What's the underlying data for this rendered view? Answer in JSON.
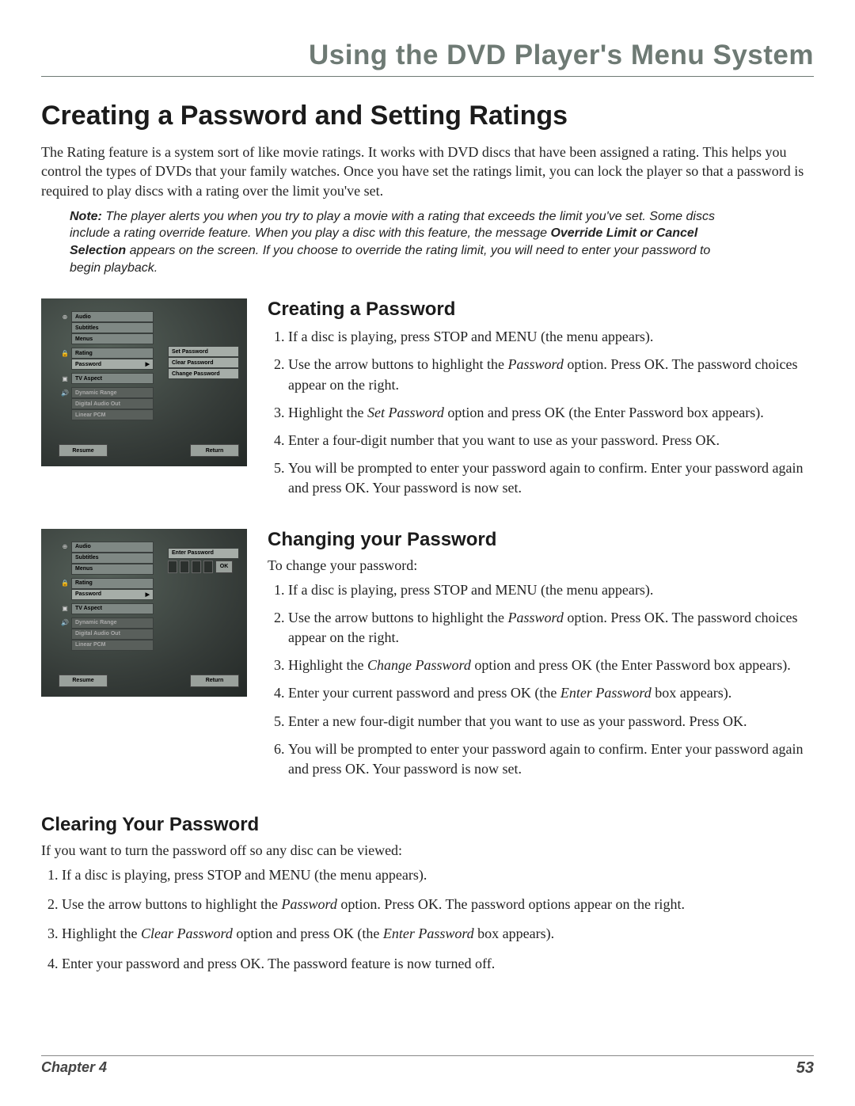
{
  "header": {
    "title": "Using the DVD Player's Menu System"
  },
  "main_heading": "Creating a Password and Setting Ratings",
  "intro": "The Rating feature is a system sort of like movie ratings. It works with DVD discs that have been assigned a rating. This helps you control the types of DVDs that your family watches. Once you have set the ratings limit, you can lock the player so that a password is required to play discs with a rating over the limit you've set.",
  "note": {
    "label": "Note:",
    "part1": " The player alerts you when you try to play a movie with a rating that exceeds the limit you've set. Some discs include a rating override feature. When you play a disc with this feature, the message ",
    "bold2": "Override Limit or Cancel Selection",
    "part2": " appears on the screen. If you choose to override the rating limit, you will need to enter your password to begin playback."
  },
  "creating": {
    "heading": "Creating a Password",
    "steps": [
      "If a disc is playing, press STOP and MENU (the menu appears).",
      "Use the arrow buttons to highlight the Password option. Press OK. The password choices appear on the right.",
      "Highlight the Set Password option and press OK (the Enter Password box appears).",
      "Enter a four-digit number that you want to use as your password. Press OK.",
      "You will be prompted to enter your password again to confirm. Enter your password again and press OK. Your password is now set."
    ]
  },
  "changing": {
    "heading": "Changing your Password",
    "intro": "To change your password:",
    "steps": [
      "If a disc is playing, press STOP and MENU (the menu appears).",
      "Use the arrow buttons to highlight the Password option. Press OK. The password choices appear on the right.",
      "Highlight the Change Password option and press OK (the Enter Password box appears).",
      "Enter your current password and press OK (the Enter Password box appears).",
      "Enter a new four-digit number that you want to use as your password. Press OK.",
      "You will be prompted to enter your password again to confirm. Enter your password again and press OK. Your password is now set."
    ]
  },
  "clearing": {
    "heading": "Clearing Your Password",
    "intro": "If you want to turn the password off so any disc can be viewed:",
    "steps": [
      "If a disc is playing, press STOP and MENU (the menu appears).",
      "Use the arrow buttons to highlight the Password option. Press OK. The password options appear on the right.",
      "Highlight the Clear Password option and press OK (the Enter Password box appears).",
      "Enter your password and press OK. The password feature is now turned off."
    ]
  },
  "dvd_menu": {
    "items_left": [
      "Audio",
      "Subtitles",
      "Menus",
      "Rating",
      "Password",
      "TV Aspect",
      "Dynamic Range",
      "Digital Audio Out",
      "Linear PCM"
    ],
    "password_opts": [
      "Set Password",
      "Clear Password",
      "Change Password"
    ],
    "enter_label": "Enter Password",
    "ok": "OK",
    "resume": "Resume",
    "return": "Return"
  },
  "footer": {
    "chapter": "Chapter 4",
    "page": "53"
  }
}
